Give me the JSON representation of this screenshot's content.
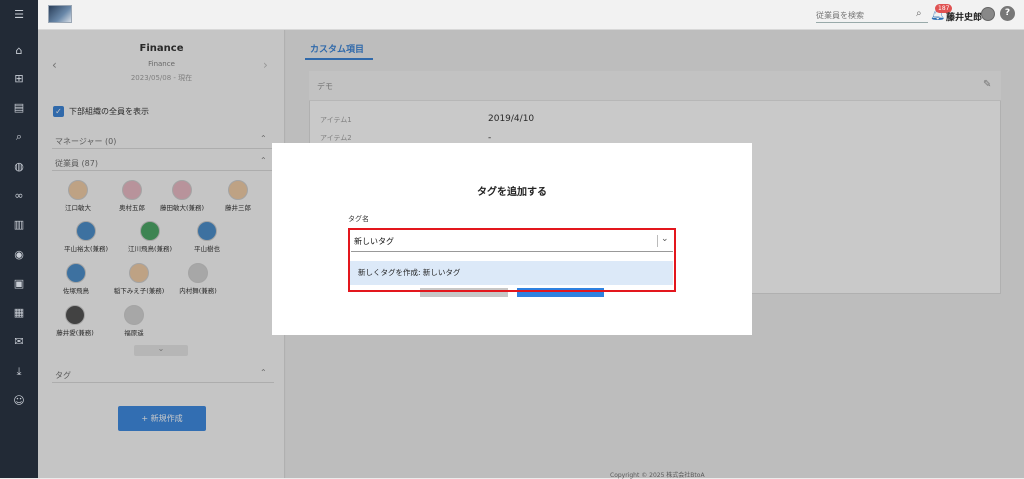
{
  "nav_icons": [
    "menu-icon",
    "home-icon",
    "org-icon",
    "document-icon",
    "search-icon",
    "chat-icon",
    "link-icon",
    "chart-icon",
    "compass-icon",
    "contact-icon",
    "book-icon",
    "mail-icon",
    "download-icon",
    "user-settings-icon"
  ],
  "header": {
    "search_placeholder": "従業員を検索",
    "notification_count": "187",
    "user_name": "藤井史郎",
    "help_label": "?"
  },
  "org": {
    "name": "Finance",
    "sub": "Finance",
    "date": "2023/05/08 - 現在",
    "prev": "‹",
    "next": "›"
  },
  "show_sub_label": "下部組織の全員を表示",
  "managers_label": "マネージャー (0)",
  "employees_label": "従業員 (87)",
  "employees": [
    {
      "name": "江口敏大",
      "color": "#f0c9a0"
    },
    {
      "name": "奥村五郎",
      "color": "#e8b4c0"
    },
    {
      "name": "藤田敏大(兼務)",
      "color": "#e8b4c0"
    },
    {
      "name": "藤井三郎",
      "color": "#f0c9a0"
    },
    {
      "name": "平山裕太(兼務)",
      "color": "#3d86c6"
    },
    {
      "name": "江川飛鳥(兼務)",
      "color": "#3ea05a"
    },
    {
      "name": "平山樹也",
      "color": "#3d86c6"
    },
    {
      "name": "佐塚飛鳥",
      "color": "#3d86c6"
    },
    {
      "name": "稲下みえ子(兼務)",
      "color": "#f0c9a0"
    },
    {
      "name": "内村舞(兼務)",
      "color": "#d0d0d0"
    },
    {
      "name": "藤井愛(兼務)",
      "color": "#444444"
    },
    {
      "name": "福原遥",
      "color": "#d0d0d0"
    }
  ],
  "more_label": "⌄",
  "tags_label": "タグ",
  "new_button": "+ 新規作成",
  "main": {
    "tab": "カスタム項目",
    "card_title": "デモ",
    "rows": [
      {
        "label": "アイテム1",
        "value": "2019/4/10"
      },
      {
        "label": "アイテム2",
        "value": "-"
      }
    ]
  },
  "modal": {
    "title": "タグを追加する",
    "field_label": "タグ名",
    "input_value": "新しいタグ",
    "option": "新しくタグを作成: 新しいタグ"
  },
  "footer": "Copyright © 2025 株式会社BtoA",
  "colors": {
    "accent": "#2b7bd5",
    "highlight": "#e3161d",
    "rail": "#222a36"
  }
}
